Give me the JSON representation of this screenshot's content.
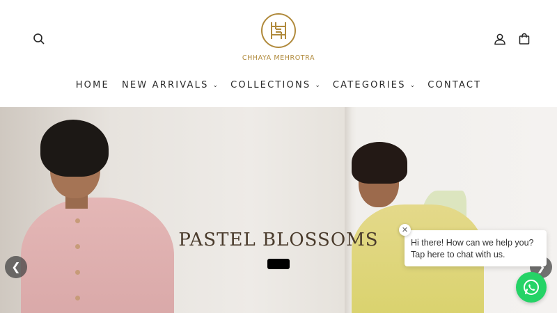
{
  "header": {
    "brand_name": "CHHAYA MEHROTRA",
    "icons": {
      "search": "search-icon",
      "account": "user-icon",
      "cart": "shopping-bag-icon"
    },
    "nav": [
      {
        "label": "HOME",
        "has_dropdown": false
      },
      {
        "label": "NEW ARRIVALS",
        "has_dropdown": true
      },
      {
        "label": "COLLECTIONS",
        "has_dropdown": true
      },
      {
        "label": "CATEGORIES",
        "has_dropdown": true
      },
      {
        "label": "CONTACT",
        "has_dropdown": false
      }
    ]
  },
  "hero": {
    "title": "PASTEL BLOSSOMS",
    "button_label": "",
    "prev_arrow": "❮",
    "next_arrow": "❯"
  },
  "chat": {
    "message": "Hi there! How can we help you? Tap here to chat with us.",
    "close_glyph": "✕",
    "whatsapp_icon": "whatsapp-icon"
  },
  "colors": {
    "brand_gold": "#b08a3c",
    "nav_text": "#2a2a2a",
    "whatsapp_green": "#25d366",
    "hero_title": "#4a3b2c"
  }
}
